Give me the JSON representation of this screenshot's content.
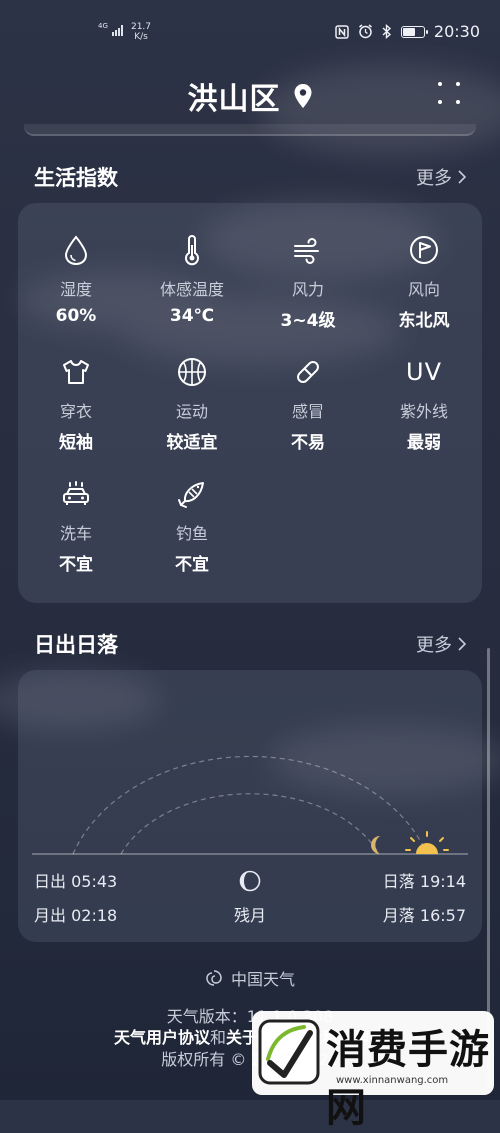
{
  "status_bar": {
    "network": "4G",
    "speed_value": "21.7",
    "speed_unit": "K/s",
    "time": "20:30",
    "battery_percent": 65,
    "icons": [
      "nfc-icon",
      "alarm-icon",
      "bluetooth-icon",
      "battery-icon",
      "signal-icon"
    ]
  },
  "header": {
    "city": "洪山区",
    "icons": [
      "location-pin-icon",
      "menu-dots-icon"
    ]
  },
  "life_index": {
    "title": "生活指数",
    "more": "更多",
    "items": [
      {
        "icon": "droplet-icon",
        "label": "湿度",
        "value": "60%"
      },
      {
        "icon": "thermometer-icon",
        "label": "体感温度",
        "value": "34℃"
      },
      {
        "icon": "wind-icon",
        "label": "风力",
        "value": "3~4级"
      },
      {
        "icon": "wind-direction-flag-icon",
        "label": "风向",
        "value": "东北风"
      },
      {
        "icon": "tshirt-icon",
        "label": "穿衣",
        "value": "短袖"
      },
      {
        "icon": "basketball-icon",
        "label": "运动",
        "value": "较适宜"
      },
      {
        "icon": "pill-icon",
        "label": "感冒",
        "value": "不易"
      },
      {
        "icon": "uv-icon",
        "label": "紫外线",
        "value": "最弱",
        "icon_text": "UV"
      },
      {
        "icon": "car-wash-icon",
        "label": "洗车",
        "value": "不宜"
      },
      {
        "icon": "fish-icon",
        "label": "钓鱼",
        "value": "不宜"
      }
    ]
  },
  "sun_moon": {
    "title": "日出日落",
    "more": "更多",
    "sunrise_label": "日出",
    "sunrise_time": "05:43",
    "sunset_label": "日落",
    "sunset_time": "19:14",
    "moonrise_label": "月出",
    "moonrise_time": "02:18",
    "moonset_label": "月落",
    "moonset_time": "16:57",
    "moon_phase": "残月",
    "icons": [
      "sun-icon",
      "crescent-moon-icon",
      "moon-phase-icon"
    ]
  },
  "footer": {
    "brand": "中国天气",
    "version": "天气版本：11.1.0.308",
    "agreement_link": "天气用户协议",
    "agreement_joiner": "和",
    "privacy_link": "关于天气与隐私的声明",
    "copyright": "版权所有 © 2018-2021"
  },
  "watermark": {
    "title": "消费手游网",
    "url": "www.xinnanwang.com"
  },
  "colors": {
    "background_top": "#2d3346",
    "background_bottom": "#1f2637",
    "card": "#4a5167",
    "muted_text": "#c8cdd9",
    "sun_yellow": "#f2c14e",
    "moon_tan": "#d8b56a"
  }
}
